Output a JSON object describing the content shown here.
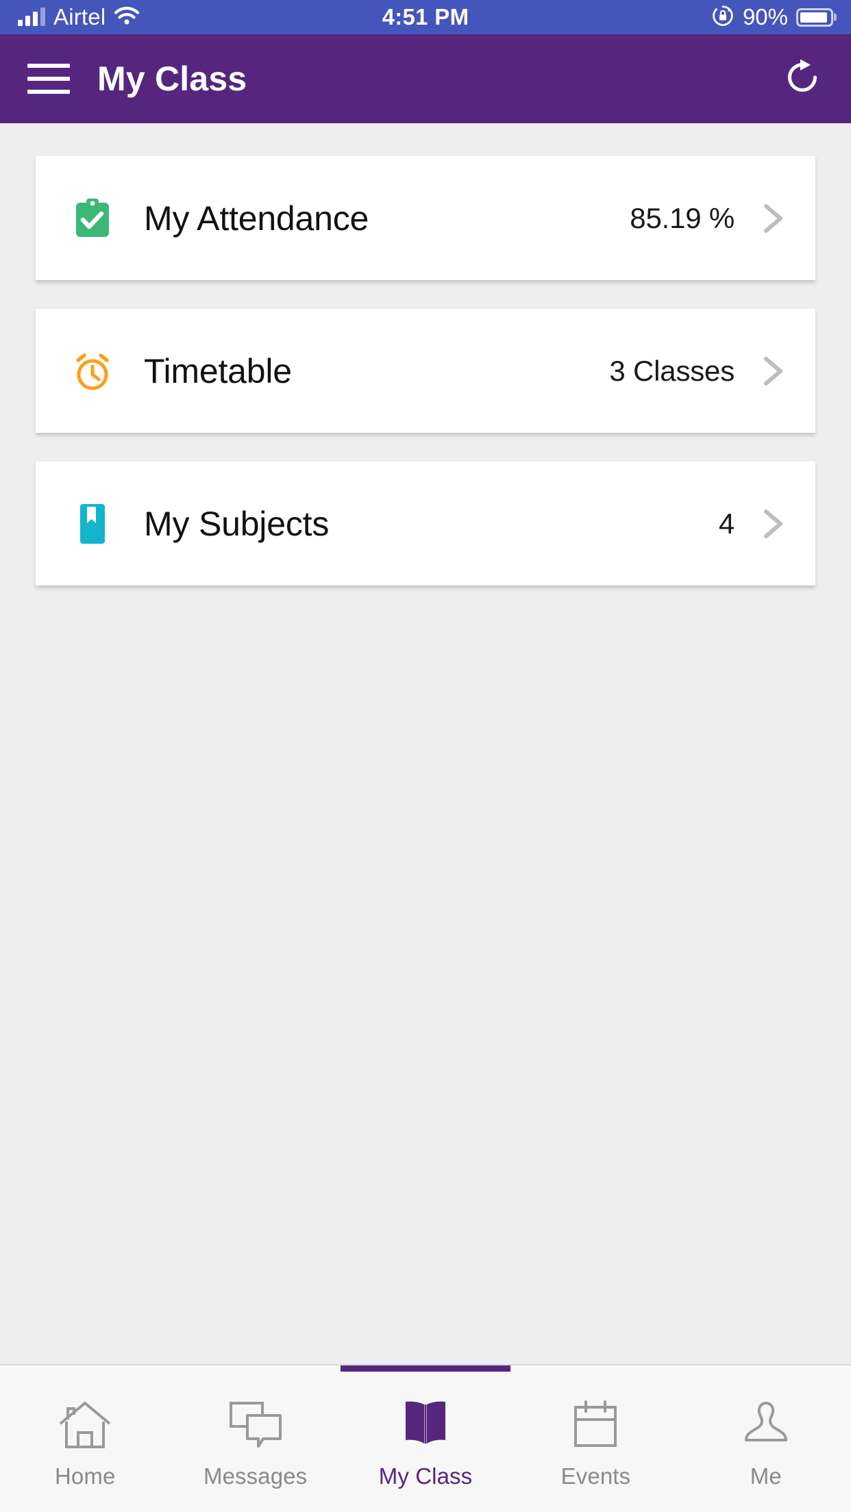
{
  "statusbar": {
    "carrier": "Airtel",
    "time": "4:51 PM",
    "battery_percent": "90%",
    "icons": {
      "signal": "signal-bars-icon",
      "wifi": "wifi-icon",
      "rotation_lock": "rotation-lock-icon",
      "battery": "battery-icon"
    },
    "background_color": "#4455bb"
  },
  "appbar": {
    "title": "My Class",
    "menu_icon": "hamburger-menu-icon",
    "refresh_icon": "refresh-icon",
    "background_color": "#56267f"
  },
  "cards": [
    {
      "icon": "clipboard-check-icon",
      "icon_color": "#3bb878",
      "label": "My Attendance",
      "value": "85.19 %",
      "chevron": "chevron-right-icon"
    },
    {
      "icon": "alarm-clock-icon",
      "icon_color": "#f9a01b",
      "label": "Timetable",
      "value": "3 Classes",
      "chevron": "chevron-right-icon"
    },
    {
      "icon": "bookmark-book-icon",
      "icon_color": "#14b4cd",
      "label": "My Subjects",
      "value": "4",
      "chevron": "chevron-right-icon"
    }
  ],
  "bottomnav": {
    "active_index": 2,
    "active_color": "#56267f",
    "inactive_color": "#8a8a8a",
    "tabs": [
      {
        "label": "Home",
        "icon": "home-icon"
      },
      {
        "label": "Messages",
        "icon": "chat-bubbles-icon"
      },
      {
        "label": "My Class",
        "icon": "open-book-icon"
      },
      {
        "label": "Events",
        "icon": "calendar-icon"
      },
      {
        "label": "Me",
        "icon": "person-icon"
      }
    ]
  }
}
